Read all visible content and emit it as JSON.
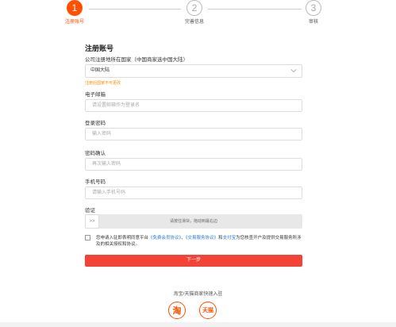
{
  "steps": [
    {
      "number": "1",
      "label": "注册账号"
    },
    {
      "number": "2",
      "label": "完善信息"
    },
    {
      "number": "3",
      "label": "审核"
    }
  ],
  "form": {
    "title": "注册账号",
    "country_label": "公司注册地所在国家（中国商家选中国大陆）",
    "country_value": "中国大陆",
    "country_warning": "注册后国家不可更改",
    "email_label": "电子邮箱",
    "email_placeholder": "请设置邮箱作为登录名",
    "password_label": "登录密码",
    "password_placeholder": "输入密码",
    "confirm_label": "密码确认",
    "confirm_placeholder": "再次输入密码",
    "phone_label": "手机号码",
    "phone_placeholder": "请输入手机号码",
    "verify_label": "验证",
    "slider_handle": ">>",
    "slider_text": "请按住滑块，拖动到最右边",
    "agree_prefix": "您申请入驻即表明同意平台",
    "agree_link1": "《免费会员协议》",
    "agree_sep": "、",
    "agree_link2": "《交易服务协议》",
    "agree_mid": "和",
    "agree_link3": "支付宝",
    "agree_suffix": "为您核查开户及提供交易服务所涉及的相关授权和协议。",
    "next_button": "下一步"
  },
  "quick": {
    "text": "淘宝/天猫商家快速入驻",
    "taobao_logo": "淘",
    "tmall_logo": "天猫"
  },
  "colors": {
    "accent": "#ff5000",
    "button": "#f44236",
    "link": "#2a78d8",
    "warning": "#ff8a00"
  }
}
